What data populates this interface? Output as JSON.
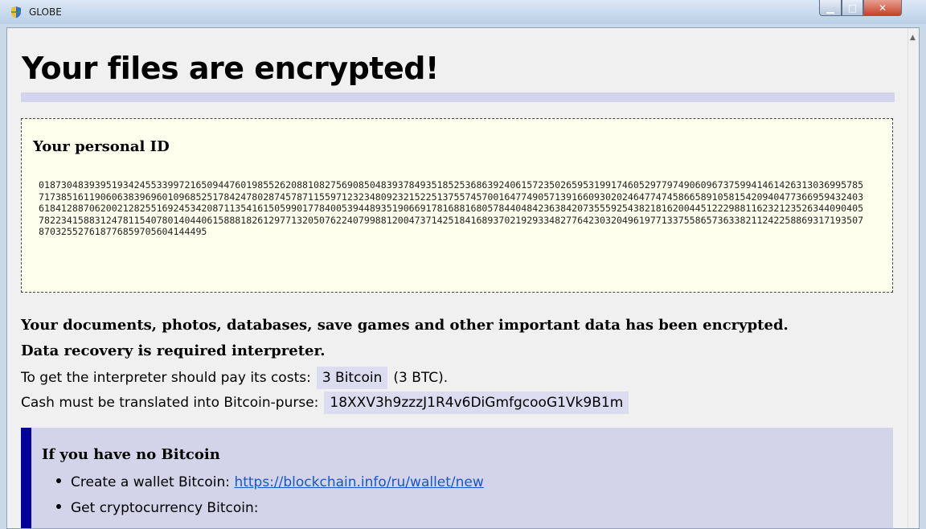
{
  "window": {
    "title": "GLOBE"
  },
  "page": {
    "heading": "Your files are encrypted!",
    "id_box": {
      "title": "Your personal ID",
      "value": "018730483939519342455339972165094476019855262088108275690850483937849351852536863924061572350265953199174605297797490609673759941461426313036995785717385161190606383969601096852517842478028745787115597123234809232152251375574570016477490571391660930202464774745866589105815420940477366959432403618412887062002128255169245342087113541615059901778400539448935190669178168816805784404842363842073555925438218162004451222988116232123526344090405782234158831247811540780140440615888182612977132050762240799881200473714251841689370219293348277642303204961977133755865736338211242258869317193507870325527618776859705604144495"
    },
    "line1": "Your documents, photos, databases, save games and other important data has been encrypted.",
    "line2": "Data recovery is required interpreter.",
    "line3": {
      "label": "To get the interpreter should pay its costs:",
      "amount": "3 Bitcoin",
      "suffix": "(3 BTC)."
    },
    "line4": {
      "label": "Cash must be translated into Bitcoin-purse:",
      "address": "18XXV3h9zzzJ1R4v6DiGmfgcooG1Vk9B1m"
    },
    "no_bitcoin": {
      "title": "If you have no Bitcoin",
      "item1_label": "Create a wallet Bitcoin:",
      "item1_link": "https://blockchain.info/ru/wallet/new",
      "item2_label": "Get cryptocurrency Bitcoin:"
    }
  },
  "colors": {
    "rule": "#d4d4ec",
    "id_box_bg": "#ffffee",
    "highlight": "#dcdcf0",
    "panel_bg": "#d3d3ea",
    "panel_bar": "#000099",
    "link": "#1a56c8"
  }
}
